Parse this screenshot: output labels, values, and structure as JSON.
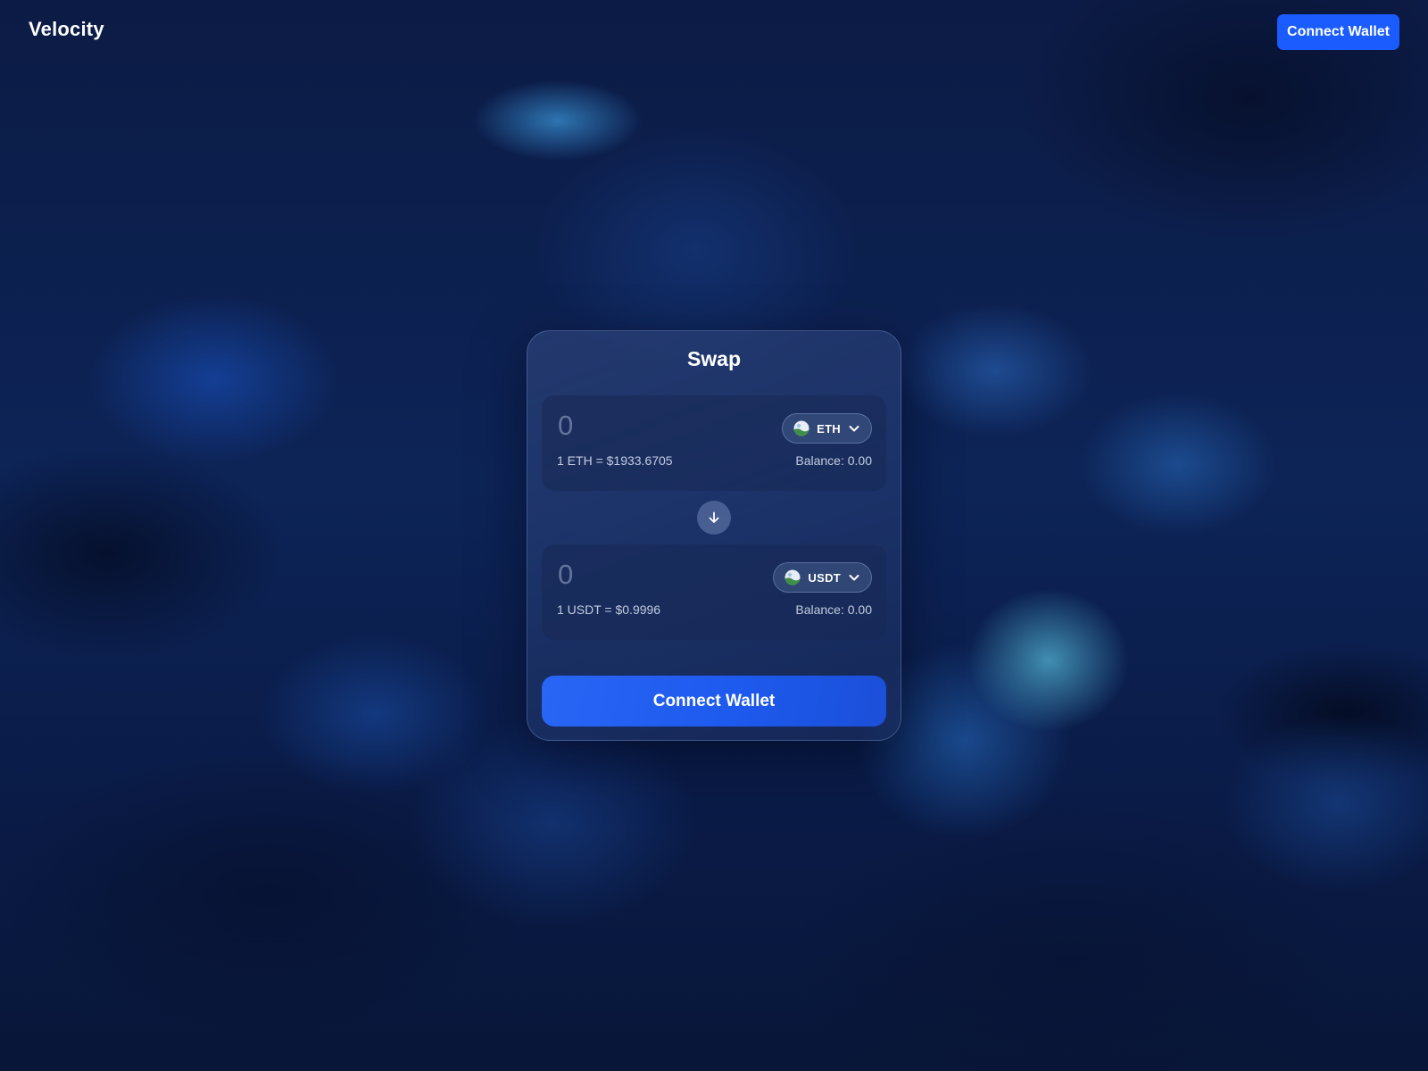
{
  "header": {
    "logo": "Velocity",
    "connect_label": "Connect Wallet"
  },
  "swap": {
    "title": "Swap",
    "from": {
      "placeholder": "0",
      "value": "",
      "token_symbol": "ETH",
      "token_icon": "eth-token-icon",
      "rate": "1 ETH = $1933.6705",
      "balance": "Balance: 0.00"
    },
    "flip_icon": "arrow-down-icon",
    "to": {
      "placeholder": "0",
      "value": "",
      "token_symbol": "USDT",
      "token_icon": "usdt-token-icon",
      "rate": "1 USDT = $0.9996",
      "balance": "Balance: 0.00"
    },
    "connect_label": "Connect Wallet"
  },
  "colors": {
    "accent": "#1a5cff",
    "background": "#0b1a3f"
  }
}
